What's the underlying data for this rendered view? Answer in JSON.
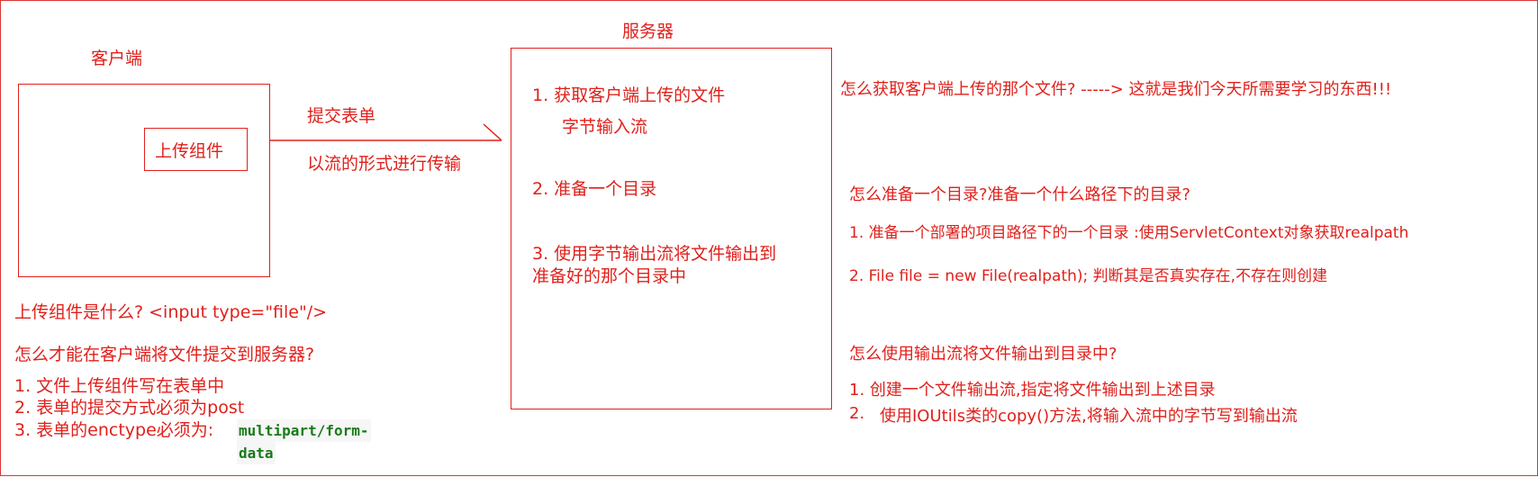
{
  "client": {
    "title": "客户端",
    "upload_component": "上传组件",
    "what_is_upload": "上传组件是什么?  <input type=\"file\"/>",
    "how_submit_question": "怎么才能在客户端将文件提交到服务器?",
    "steps": [
      "1.  文件上传组件写在表单中",
      "2.  表单的提交方式必须为post",
      "3.  表单的enctype必须为:"
    ],
    "enctype_code_line1": "multipart/form-",
    "enctype_code_line2": "data"
  },
  "arrow": {
    "label_top": "提交表单",
    "label_bottom": "以流的形式进行传输"
  },
  "server": {
    "title": "服务器",
    "step1_line1": "1.  获取客户端上传的文件",
    "step1_line2": "字节输入流",
    "step2": "2.  准备一个目录",
    "step3_line1": "3.  使用字节输出流将文件输出到",
    "step3_line2": "准备好的那个目录中"
  },
  "notes": {
    "how_get_file": "怎么获取客户端上传的那个文件?  ----->  这就是我们今天所需要学习的东西!!!",
    "how_prepare_dir": "怎么准备一个目录?准备一个什么路径下的目录?",
    "prepare_step1": "1.  准备一个部署的项目路径下的一个目录 :使用ServletContext对象获取realpath",
    "prepare_step2": "2.  File file = new File(realpath); 判断其是否真实存在,不存在则创建",
    "how_output": "怎么使用输出流将文件输出到目录中?",
    "output_step1": "1.  创建一个文件输出流,指定将文件输出到上述目录",
    "output_step2_num": "2.",
    "output_step2_text": "使用IOUtils类的copy()方法,将输入流中的字节写到输出流"
  },
  "colors": {
    "text": "#e0201b",
    "code": "#1a7a1a"
  }
}
